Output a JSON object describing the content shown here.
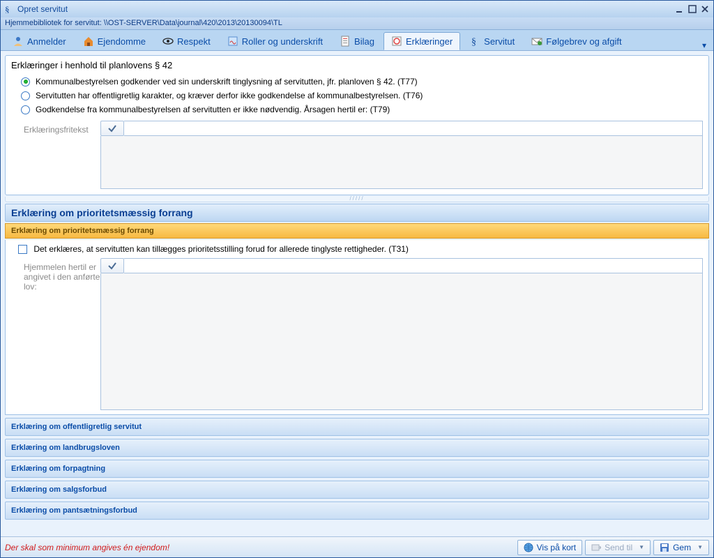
{
  "window": {
    "title": "Opret servitut",
    "path": "Hjemmebibliotek for servitut: \\\\OST-SERVER\\Data\\journal\\420\\2013\\20130094\\TL"
  },
  "tabs": {
    "anmelder": "Anmelder",
    "ejendomme": "Ejendomme",
    "respekt": "Respekt",
    "roller": "Roller og underskrift",
    "bilag": "Bilag",
    "erklaeringer": "Erklæringer",
    "servitut": "Servitut",
    "folgebrev": "Følgebrev og afgift"
  },
  "planlov": {
    "heading": "Erklæringer i henhold til planlovens § 42",
    "opt_t77": "Kommunalbestyrelsen godkender ved sin underskrift tinglysning af servitutten, jfr. planloven § 42. (T77)",
    "opt_t76": "Servitutten har offentligretlig karakter, og kræver derfor ikke godkendelse af kommunalbestyrelsen. (T76)",
    "opt_t79": "Godkendelse fra kommunalbestyrelsen af servitutten er ikke nødvendig. Årsagen hertil er: (T79)",
    "fritekst_label": "Erklæringsfritekst"
  },
  "prioritet": {
    "header_blue": "Erklæring om prioritetsmæssig forrang",
    "header_orange": "Erklæring om prioritetsmæssig forrang",
    "chk_label": "Det erklæres, at servitutten kan tillægges prioritetsstilling forud for allerede tinglyste rettigheder. (T31)",
    "hjemmel_label": "Hjemmelen hertil er angivet i den anførte lov:"
  },
  "collapsed": {
    "offentlig": "Erklæring om offentligretlig servitut",
    "landbrug": "Erklæring om landbrugsloven",
    "forpagtning": "Erklæring om forpagtning",
    "salgsforbud": "Erklæring om salgsforbud",
    "pantsaetning": "Erklæring om pantsætningsforbud"
  },
  "footer": {
    "warning": "Der skal som minimum angives én ejendom!",
    "vis_kort": "Vis på kort",
    "send_til": "Send til",
    "gem": "Gem"
  }
}
